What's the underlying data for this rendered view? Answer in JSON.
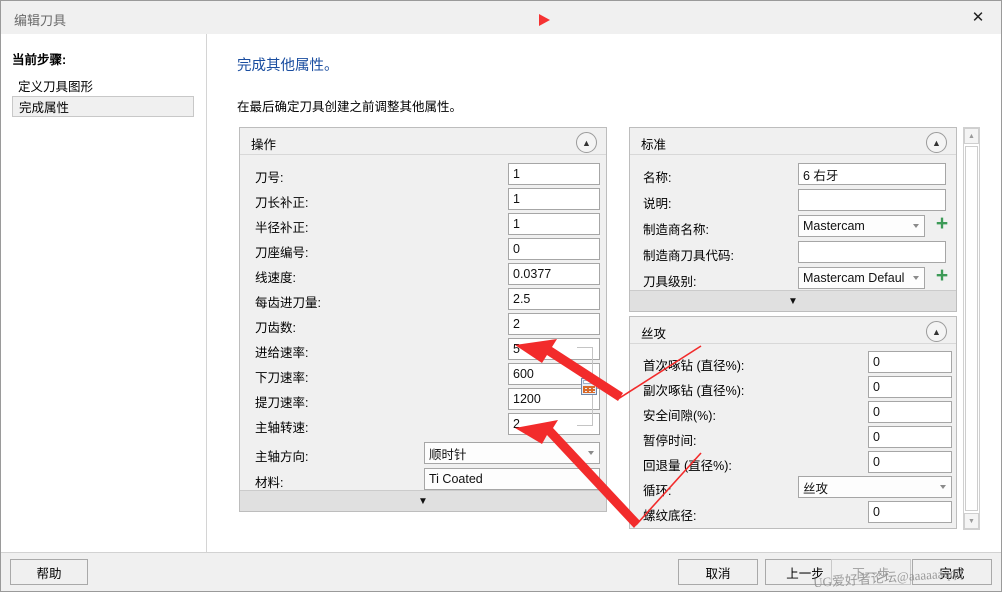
{
  "window": {
    "title": "编辑刀具",
    "close_label": "✕",
    "red_marker": "red-triangle-marker"
  },
  "steps": {
    "header": "当前步骤:",
    "items": [
      {
        "label": "定义刀具图形",
        "selected": false
      },
      {
        "label": "完成属性",
        "selected": true
      }
    ]
  },
  "page": {
    "title": "完成其他属性。",
    "subtitle": "在最后确定刀具创建之前调整其他属性。",
    "title_color": "#1b4ea0"
  },
  "operations_panel": {
    "title": "操作",
    "collapse_glyph": "▲",
    "expand_glyph": "▼",
    "rows": [
      {
        "label": "刀号:",
        "value": "1",
        "kind": "text"
      },
      {
        "label": "刀长补正:",
        "value": "1",
        "kind": "text"
      },
      {
        "label": "半径补正:",
        "value": "1",
        "kind": "text"
      },
      {
        "label": "刀座编号:",
        "value": "0",
        "kind": "text"
      },
      {
        "label": "线速度:",
        "value": "0.0377",
        "kind": "text"
      },
      {
        "label": "每齿进刀量:",
        "value": "2.5",
        "kind": "text"
      },
      {
        "label": "刀齿数:",
        "value": "2",
        "kind": "text"
      },
      {
        "label": "进给速率:",
        "value": "5",
        "kind": "text"
      },
      {
        "label": "下刀速率:",
        "value": "600",
        "kind": "text"
      },
      {
        "label": "提刀速率:",
        "value": "1200",
        "kind": "text"
      },
      {
        "label": "主轴转速:",
        "value": "2",
        "kind": "text"
      },
      {
        "label": "主轴方向:",
        "value": "顺时针",
        "kind": "select"
      },
      {
        "label": "材料:",
        "value": "Ti Coated",
        "kind": "select"
      }
    ],
    "calculator_icon": "calculator-icon"
  },
  "standard_panel": {
    "title": "标准",
    "collapse_glyph": "▲",
    "expand_glyph": "▼",
    "rows": [
      {
        "label": "名称:",
        "value": "6 右牙",
        "kind": "text",
        "plus": false
      },
      {
        "label": "说明:",
        "value": "",
        "kind": "text",
        "plus": false
      },
      {
        "label": "制造商名称:",
        "value": "Mastercam",
        "kind": "select",
        "plus": true
      },
      {
        "label": "制造商刀具代码:",
        "value": "",
        "kind": "text",
        "plus": false
      },
      {
        "label": "刀具级别:",
        "value": "Mastercam Defaul",
        "kind": "select",
        "plus": true
      }
    ],
    "plus_label": "+",
    "plus_color": "#3d9a57"
  },
  "tapping_panel": {
    "title": "丝攻",
    "collapse_glyph": "▲",
    "rows": [
      {
        "label": "首次啄钻 (直径%):",
        "value": "0",
        "kind": "text"
      },
      {
        "label": "副次啄钻 (直径%):",
        "value": "0",
        "kind": "text"
      },
      {
        "label": "安全间隙(%):",
        "value": "0",
        "kind": "text"
      },
      {
        "label": "暂停时间:",
        "value": "0",
        "kind": "text"
      },
      {
        "label": "回退量 (直径%):",
        "value": "0",
        "kind": "text"
      },
      {
        "label": "循环:",
        "value": "丝攻",
        "kind": "select"
      },
      {
        "label": "螺纹底径:",
        "value": "0",
        "kind": "text"
      }
    ]
  },
  "scrollbar": {
    "up_glyph": "▲",
    "down_glyph": "▼"
  },
  "footer": {
    "help": "帮助",
    "cancel": "取消",
    "back": "上一步",
    "next": "下一步",
    "finish": "完成"
  },
  "watermark": {
    "text": "UG爱好者论坛@aaaaaaqqq"
  }
}
